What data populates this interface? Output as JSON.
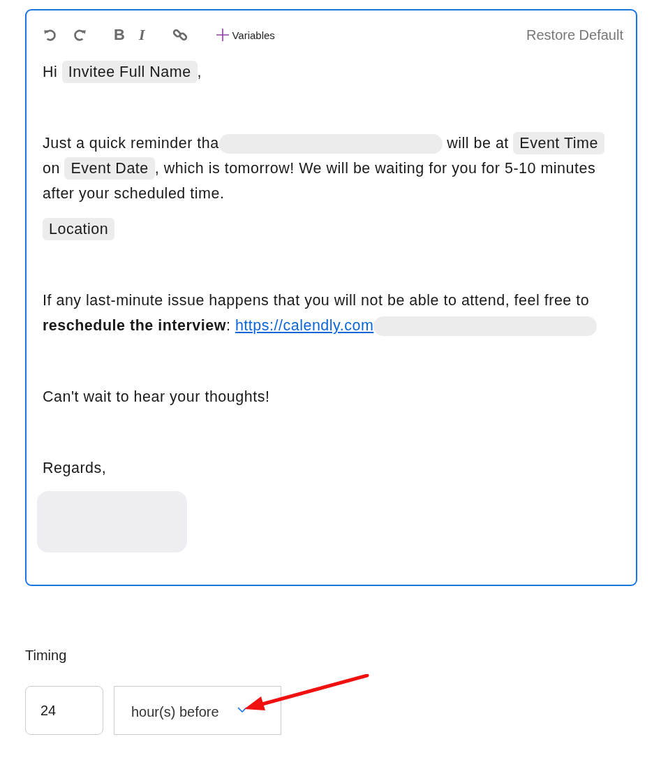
{
  "editor": {
    "toolbar": [
      {
        "kind": "undo"
      },
      {
        "kind": "redo"
      },
      {
        "kind": "bold",
        "label": "B"
      },
      {
        "kind": "italic",
        "label": "I"
      },
      {
        "kind": "link"
      },
      {
        "kind": "variables",
        "label": "Variables"
      }
    ],
    "restore_button": "Restore Default",
    "paragraphs": [
      {
        "kind": "text",
        "segments": [
          {
            "kind": "text",
            "text": "Hi "
          },
          {
            "kind": "chip",
            "text": "Invitee Full Name"
          },
          {
            "kind": "text",
            "text": ","
          }
        ]
      },
      {
        "kind": "blank"
      },
      {
        "kind": "text",
        "segments": [
          {
            "kind": "text",
            "text": "Just a quick reminder tha"
          },
          {
            "kind": "redacted"
          },
          {
            "kind": "text",
            "text": " will be at "
          },
          {
            "kind": "chip",
            "text": "Event Time"
          },
          {
            "kind": "text",
            "text": " on "
          },
          {
            "kind": "chip",
            "text": "Event Date"
          },
          {
            "kind": "text",
            "text": ", which is tomorrow! We will be waiting for you for 5-10 minutes"
          },
          {
            "kind": "text",
            "text": " after your scheduled time."
          }
        ]
      },
      {
        "kind": "text",
        "segments": [
          {
            "kind": "chip",
            "text": "Location"
          }
        ]
      },
      {
        "kind": "blank"
      },
      {
        "kind": "text",
        "segments": [
          {
            "kind": "text",
            "text": "If any last-minute issue happens that you will not be able to attend, feel free to "
          },
          {
            "kind": "bold",
            "text": "reschedule the interview"
          },
          {
            "kind": "text",
            "text": ": "
          },
          {
            "kind": "link",
            "text": "https://calendly.com"
          },
          {
            "kind": "redacted"
          }
        ]
      },
      {
        "kind": "blank"
      },
      {
        "kind": "text",
        "segments": [
          {
            "kind": "text",
            "text": "Can't wait to hear your thoughts!"
          }
        ]
      },
      {
        "kind": "blank"
      },
      {
        "kind": "text",
        "segments": [
          {
            "kind": "text",
            "text": "Regards,"
          }
        ]
      },
      {
        "kind": "signature"
      }
    ]
  },
  "timing": {
    "label": "Timing",
    "amount": "24",
    "unit": "hour(s) before"
  },
  "annotation": {
    "kind": "arrow"
  }
}
